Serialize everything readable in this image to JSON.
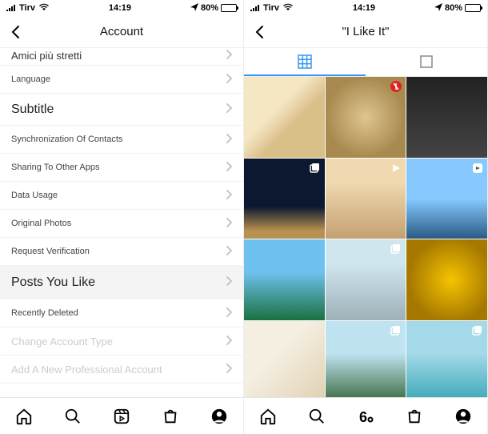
{
  "status": {
    "carrier": "Tirv",
    "time": "14:19",
    "battery_pct": "80%"
  },
  "left": {
    "title": "Account",
    "rows": [
      {
        "label": "Amici più stretti",
        "kind": "cut-top"
      },
      {
        "label": "Language",
        "kind": "small"
      },
      {
        "label": "Subtitle",
        "kind": "big"
      },
      {
        "label": "Synchronization Of Contacts",
        "kind": "small"
      },
      {
        "label": "Sharing To Other Apps",
        "kind": "small"
      },
      {
        "label": "Data Usage",
        "kind": "small"
      },
      {
        "label": "Original Photos",
        "kind": "small"
      },
      {
        "label": "Request Verification",
        "kind": "small"
      },
      {
        "label": "Posts You Like",
        "kind": "highlight"
      },
      {
        "label": "Recently Deleted",
        "kind": "small"
      },
      {
        "label": "Change Account Type",
        "kind": "faded"
      },
      {
        "label": "Add A New Professional Account",
        "kind": "faded"
      }
    ]
  },
  "right": {
    "title": "\"I Like It\"",
    "tabs": {
      "grid_active": true
    },
    "thumbs": [
      {
        "cls": "t1",
        "badge": null
      },
      {
        "cls": "t2",
        "badge": "circle-red"
      },
      {
        "cls": "t3",
        "badge": null
      },
      {
        "cls": "t4",
        "badge": "multi"
      },
      {
        "cls": "t5",
        "badge": "video"
      },
      {
        "cls": "t6",
        "badge": "reel"
      },
      {
        "cls": "t7",
        "badge": null
      },
      {
        "cls": "t8",
        "badge": "multi"
      },
      {
        "cls": "t9",
        "badge": null
      },
      {
        "cls": "t10",
        "badge": null
      },
      {
        "cls": "t11",
        "badge": "multi"
      },
      {
        "cls": "t12",
        "badge": "multi"
      }
    ]
  },
  "tabbar": [
    "home",
    "search",
    "reels",
    "shop",
    "profile"
  ],
  "icons": {
    "grid": "grid-icon",
    "feed": "feed-icon"
  }
}
